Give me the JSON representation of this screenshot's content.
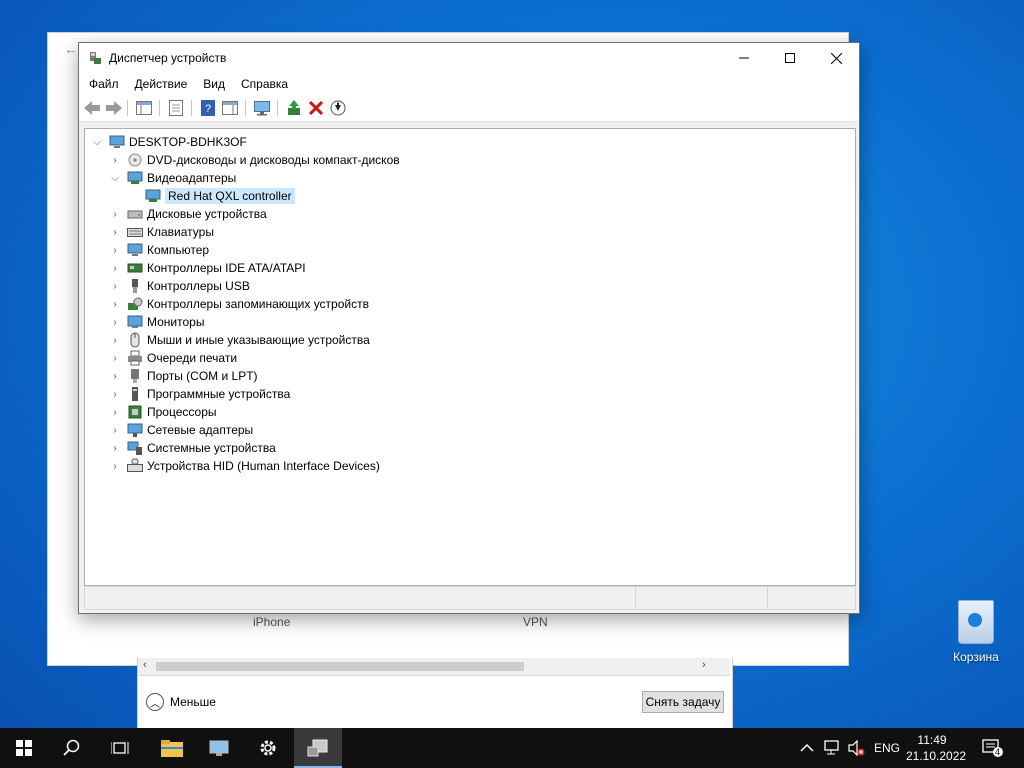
{
  "window": {
    "title": "Диспетчер устройств",
    "minimize_icon": "minimize-icon",
    "maximize_icon": "maximize-icon",
    "close_icon": "close-icon"
  },
  "menu": [
    "Файл",
    "Действие",
    "Вид",
    "Справка"
  ],
  "toolbar": [
    "back-arrow-icon",
    "forward-arrow-icon",
    "show-hide-console-tree-icon",
    "properties-icon",
    "help-icon",
    "action-pane-icon",
    "monitor-scan-icon",
    "update-driver-icon",
    "uninstall-icon",
    "disable-device-icon"
  ],
  "tree": {
    "root": "DESKTOP-BDHK3OF",
    "items": [
      {
        "label": "DVD-дисководы и дисководы компакт-дисков",
        "expanded": false,
        "icon": "dvd-drive-icon"
      },
      {
        "label": "Видеоадаптеры",
        "expanded": true,
        "icon": "display-adapter-icon",
        "children": [
          {
            "label": "Red Hat QXL controller",
            "selected": true,
            "icon": "display-adapter-icon"
          }
        ]
      },
      {
        "label": "Дисковые устройства",
        "expanded": false,
        "icon": "disk-drive-icon"
      },
      {
        "label": "Клавиатуры",
        "expanded": false,
        "icon": "keyboard-icon"
      },
      {
        "label": "Компьютер",
        "expanded": false,
        "icon": "computer-icon"
      },
      {
        "label": "Контроллеры IDE ATA/ATAPI",
        "expanded": false,
        "icon": "ide-controller-icon"
      },
      {
        "label": "Контроллеры USB",
        "expanded": false,
        "icon": "usb-icon"
      },
      {
        "label": "Контроллеры запоминающих устройств",
        "expanded": false,
        "icon": "storage-controller-icon"
      },
      {
        "label": "Мониторы",
        "expanded": false,
        "icon": "monitor-icon"
      },
      {
        "label": "Мыши и иные указывающие устройства",
        "expanded": false,
        "icon": "mouse-icon"
      },
      {
        "label": "Очереди печати",
        "expanded": false,
        "icon": "printer-icon"
      },
      {
        "label": "Порты (COM и LPT)",
        "expanded": false,
        "icon": "port-icon"
      },
      {
        "label": "Программные устройства",
        "expanded": false,
        "icon": "software-device-icon"
      },
      {
        "label": "Процессоры",
        "expanded": false,
        "icon": "processor-icon"
      },
      {
        "label": "Сетевые адаптеры",
        "expanded": false,
        "icon": "network-adapter-icon"
      },
      {
        "label": "Системные устройства",
        "expanded": false,
        "icon": "system-device-icon"
      },
      {
        "label": "Устройства HID (Human Interface Devices)",
        "expanded": false,
        "icon": "hid-icon"
      }
    ]
  },
  "background_window": {
    "label_iphone": "iPhone",
    "label_vpn": "VPN"
  },
  "task_manager": {
    "less_label": "Меньше",
    "end_task_label": "Снять задачу"
  },
  "desktop": {
    "recycle_bin_label": "Корзина"
  },
  "taskbar": {
    "items": [
      "start-icon",
      "search-icon",
      "task-view-icon",
      "file-explorer-icon",
      "device-manager-icon",
      "settings-icon",
      "task-manager-icon"
    ],
    "tray": {
      "language": "ENG",
      "time": "11:49",
      "date": "21.10.2022",
      "notification_count": "4"
    }
  },
  "colors": {
    "selection": "#cce8ff",
    "desktop": "#0b6fd0",
    "taskbar": "#101010"
  }
}
